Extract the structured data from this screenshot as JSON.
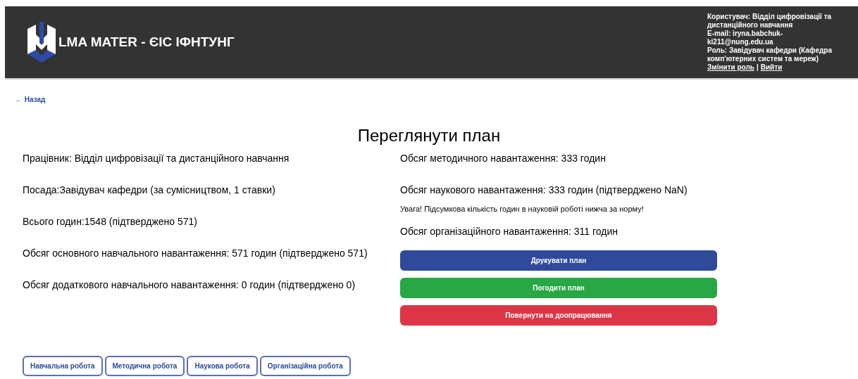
{
  "header": {
    "logo_text": "LMA MATER - ЄІС ІФНТУНГ",
    "user_lines": [
      "Користувач: Відділ цифровізації та дистанційного навчання",
      "E-mail: iryna.babchuk-ki211@nung.edu.ua",
      "Роль: Завідувач кафедри (Кафедра комп'ютерних систем та мереж)"
    ],
    "links": [
      "Змінити роль",
      "Вийти"
    ],
    "separator": "|"
  },
  "back_link": "← Назад",
  "title": "Переглянути план",
  "left_info": [
    "Працівник: Відділ цифровізації та дистанційного навчання",
    "Посада:Завідувач кафедри (за сумісництвом, 1 ставки)",
    "Всього годин:1548 (підтверджено 571)",
    "Обсяг основного навчального навантаження: 571 годин (підтверджено 571)",
    "Обсяг додаткового навчального навантаження: 0 годин (підтверджено 0)"
  ],
  "right_info": [
    {
      "kind": "line",
      "text": "Обсяг методичного навантаження: 333 годин"
    },
    {
      "kind": "line",
      "text": "Обсяг наукового навантаження: 333 годин (підтверджено NaN)"
    },
    {
      "kind": "warning",
      "text": "Увага! Підсумкова кількість годин в науковій роботі нижча за норму!"
    },
    {
      "kind": "line",
      "text": "Обсяг організаційного навантаження: 311 годин"
    }
  ],
  "actions": [
    {
      "kind": "primary",
      "label": "Друкувати план"
    },
    {
      "kind": "success",
      "label": "Погодити план"
    },
    {
      "kind": "danger",
      "label": "Повернути на доопрацювання"
    }
  ],
  "tabs": [
    "Навчальна робота",
    "Методична робота",
    "Наукова робота",
    "Організаційна робота"
  ]
}
